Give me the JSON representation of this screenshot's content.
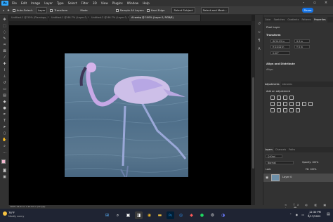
{
  "menubar": {
    "logo": "Ps",
    "items": [
      "File",
      "Edit",
      "Image",
      "Layer",
      "Type",
      "Select",
      "Filter",
      "3D",
      "View",
      "Plugins",
      "Window",
      "Help"
    ]
  },
  "options": {
    "auto_select": "Auto-Select:",
    "layer": "Layer",
    "transform": "Transform",
    "mode": "Mode",
    "all_layers": "Sample All Layers",
    "hard_edge": "Hard Edge",
    "select_subject": "Select Subject",
    "select_mask": "Select and Mask...",
    "share": "Share"
  },
  "tabs": [
    "Untitled-1 @ 50% (Flamingo, RGB/8)",
    "Untitled-1 @ 66.7% (Layer 0, RGB/8)",
    "Untitled-2 @ 66.7% (Layer 0, RGB/8)",
    "AI.webp @ 100% (Layer 0, RGB/8)"
  ],
  "status": "100%   24.02 in x 24.02 in (72 ppi)",
  "properties": {
    "tabs": [
      "Color",
      "Swatches",
      "Gradients",
      "Patterns",
      "Properties"
    ],
    "pixel_layer": "Pixel Layer",
    "transform": "Transform",
    "w": "W 24.02 in",
    "h": "H 24.02 in",
    "x": "X 0 in",
    "y": "Y 0 in",
    "angle": "0.00°",
    "align": "Align and Distribute",
    "align_sub": "Align:"
  },
  "adjustments": {
    "tabs": [
      "Adjustments",
      "Libraries"
    ],
    "add_label": "Add an adjustment"
  },
  "layers": {
    "tabs": [
      "Layers",
      "Channels",
      "Paths"
    ],
    "kind": "Q Kind",
    "blend": "Normal",
    "opacity": "Opacity: 100%",
    "lock": "Lock:",
    "fill": "Fill: 100%",
    "layer_name": "Layer 0"
  },
  "taskbar": {
    "weather_temp": "78°F",
    "weather_desc": "Mostly sunny",
    "time": "12:30 PM",
    "date": "9/17/2022"
  },
  "colors": {
    "accent": "#1473e6",
    "panel": "#323232",
    "canvas": "#000000"
  }
}
